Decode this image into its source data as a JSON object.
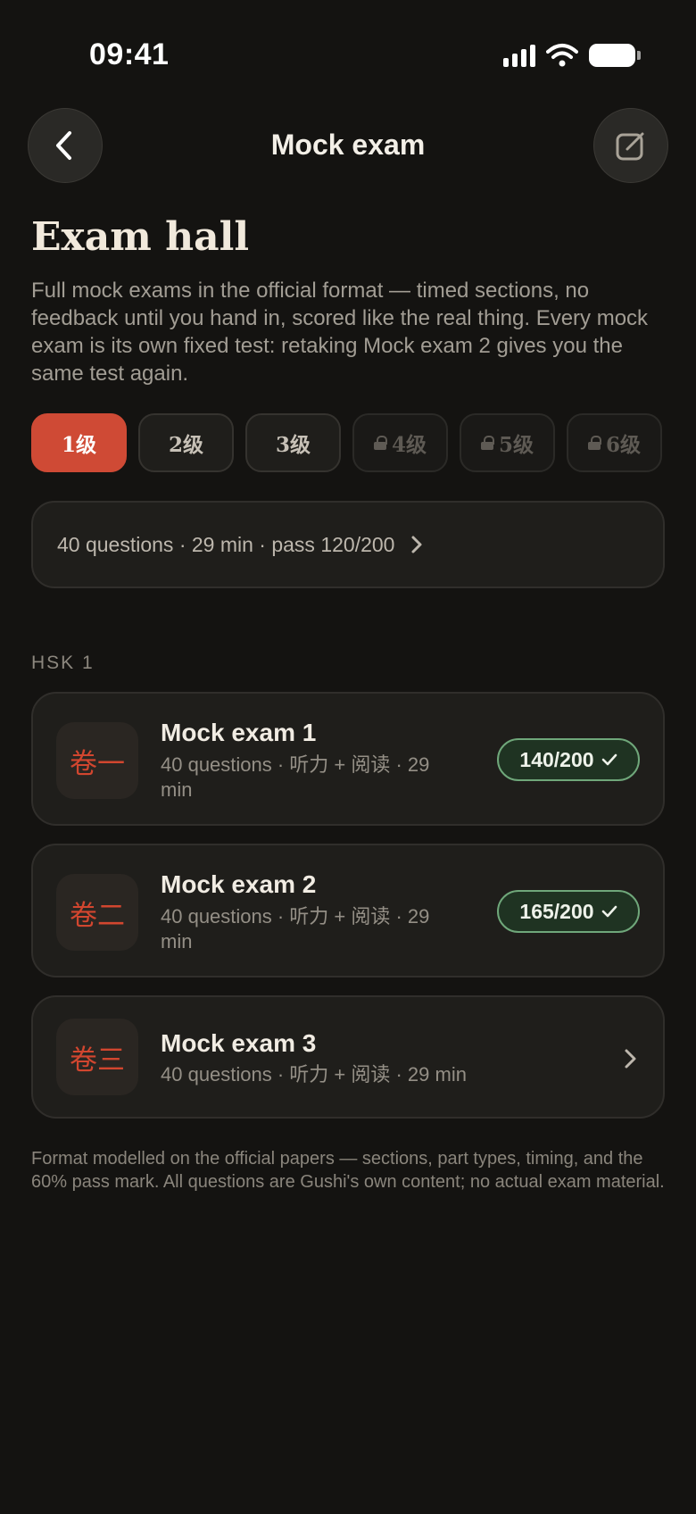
{
  "status_bar": {
    "time": "09:41"
  },
  "nav": {
    "title": "Mock exam"
  },
  "page": {
    "title": "Exam hall",
    "intro": "Full mock exams in the official format — timed sections, no feedback until you hand in, scored like the real thing. Every mock exam is its own fixed test: retaking Mock exam 2 gives you the same test again."
  },
  "levels": [
    {
      "label": "1级",
      "state": "active"
    },
    {
      "label": "2级",
      "state": "available"
    },
    {
      "label": "3级",
      "state": "available"
    },
    {
      "label": "4级",
      "state": "locked"
    },
    {
      "label": "5级",
      "state": "locked"
    },
    {
      "label": "6级",
      "state": "locked"
    }
  ],
  "info_card": {
    "text": "40 questions · 29 min · pass 120/200"
  },
  "section": {
    "label": "HSK 1"
  },
  "exams": [
    {
      "seal": "卷一",
      "title": "Mock exam 1",
      "meta": "40 questions · 听力 + 阅读 · 29 min",
      "score": "140/200",
      "completed": true
    },
    {
      "seal": "卷二",
      "title": "Mock exam 2",
      "meta": "40 questions · 听力 + 阅读 · 29 min",
      "score": "165/200",
      "completed": true
    },
    {
      "seal": "卷三",
      "title": "Mock exam 3",
      "meta": "40 questions · 听力 + 阅读 · 29 min",
      "score": null,
      "completed": false
    }
  ],
  "footer": {
    "note": "Format modelled on the official papers — sections, part types, timing, and the 60% pass mark. All questions are Gushi's own content; no actual exam material."
  },
  "colors": {
    "accent": "#cf4a35",
    "success_border": "#6fa77a",
    "background": "#141311"
  },
  "icons": [
    "back-chevron-icon",
    "edit-icon",
    "lock-icon",
    "chevron-right-icon",
    "checkmark-icon"
  ]
}
